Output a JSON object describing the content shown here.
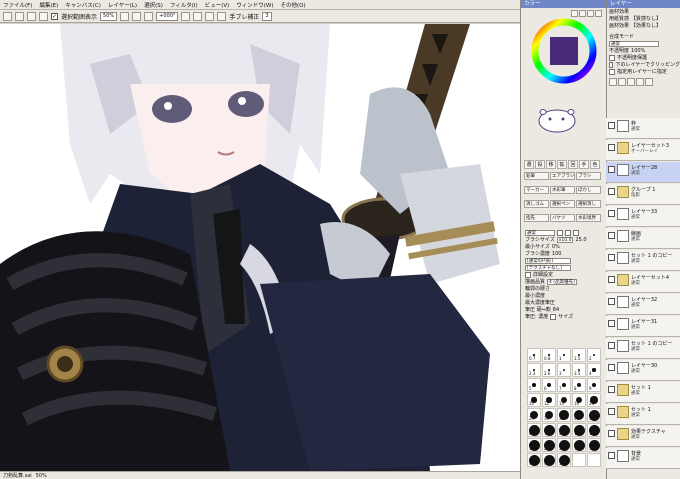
{
  "menubar": {
    "items": [
      "ファイル(F)",
      "編集(E)",
      "キャンバス(C)",
      "レイヤー(L)",
      "選択(S)",
      "フィルタ(I)",
      "ビュー(V)",
      "ウィンドウ(W)",
      "その他(O)"
    ]
  },
  "toolbar": {
    "aa_label": "選択範囲表示",
    "zoom_value": "50%",
    "angle_value": "+000°",
    "stabilizer_label": "手ブレ補正",
    "stabilizer_value": "3"
  },
  "statusbar": {
    "filename": "刀剣乱舞.sai",
    "zoom": "50%"
  },
  "color_panel": {
    "title": "カラー",
    "sv_color": "#4b2a7a",
    "hue_ring": "rainbow"
  },
  "tool_panel": {
    "tools": [
      "選",
      "投",
      "移",
      "拡",
      "回",
      "手",
      "ス",
      "消",
      "色"
    ],
    "brushes": [
      [
        "鉛筆",
        "エアブラシ",
        "ブラシ"
      ],
      [
        "マーカー",
        "水彩筆",
        "ぼかし"
      ],
      [
        "消しゴム",
        "選択ペン",
        "選択消し"
      ],
      [
        "指先",
        "バケツ",
        "水彩境界"
      ]
    ],
    "mode_label": "通常",
    "size_label": "ブラシサイズ",
    "size_mult": "x10.0",
    "size_value": "25.0",
    "min_size_label": "最小サイズ",
    "min_size_value": "0%",
    "density_label": "ブラシ濃度",
    "density_value": "100",
    "shape1": "[通常の円形]",
    "shape2": "[テクスチャなし]",
    "advanced_label": "詳細設定",
    "quality_label": "描画品質",
    "quality_value": "4 (品質優先)",
    "edge_label": "輪郭の硬さ",
    "min_density_label": "最小濃度",
    "max_pressure_label": "最大濃度筆圧",
    "pressure_label": "筆圧 硬⇔軟",
    "pressure_value": "84",
    "pressure2_label": "筆圧: 濃度",
    "pressure3_label": "サイズ",
    "brush_sizes": [
      [
        "0.7",
        "0.8",
        "1",
        "1.5",
        "2"
      ],
      [
        "2.3",
        "2.6",
        "3",
        "3.5",
        "4"
      ],
      [
        "5",
        "6",
        "7",
        "8",
        "9"
      ],
      [
        "10",
        "12",
        "14",
        "16",
        "20"
      ],
      [
        "25",
        "30",
        "35",
        "40",
        "50"
      ],
      [
        "60",
        "70",
        "80",
        "100",
        "120"
      ],
      [
        "160",
        "200",
        "250",
        "300",
        "350"
      ],
      [
        "400",
        "450",
        "500",
        "",
        ""
      ]
    ]
  },
  "layer_panel": {
    "title": "レイヤー",
    "effect_label": "画材効果",
    "paper_label": "用紙質感",
    "paper_value": "【質感なし】",
    "effect_value": "【効果なし】",
    "blend_label": "合成モード",
    "blend_value": "通常",
    "opacity_label": "不透明度",
    "opacity_value": "100%",
    "protect_label": "不透明度保護",
    "clip_label": "下のレイヤーでクリッピング",
    "reference_label": "指定用レイヤーに指定",
    "layers": [
      {
        "name": "枠",
        "mode": "通常",
        "type": "layer"
      },
      {
        "name": "レイヤーセット3",
        "mode": "オーバーレイ",
        "type": "folder"
      },
      {
        "name": "レイヤー28",
        "mode": "通常",
        "type": "layer",
        "selected": true
      },
      {
        "name": "グループ 1",
        "mode": "陰影",
        "type": "folder"
      },
      {
        "name": "レイヤー33",
        "mode": "通常",
        "type": "layer"
      },
      {
        "name": "線画",
        "mode": "通常",
        "type": "layer"
      },
      {
        "name": "セット 1 のコピー",
        "mode": "通常",
        "type": "layer"
      },
      {
        "name": "レイヤーセット4",
        "mode": "通常",
        "type": "folder"
      },
      {
        "name": "レイヤー32",
        "mode": "通常",
        "type": "layer"
      },
      {
        "name": "レイヤー31",
        "mode": "通常",
        "type": "layer"
      },
      {
        "name": "セット 1 のコピー",
        "mode": "通常",
        "type": "layer"
      },
      {
        "name": "レイヤー30",
        "mode": "通常",
        "type": "layer"
      },
      {
        "name": "セット 1",
        "mode": "通常",
        "type": "folder"
      },
      {
        "name": "セット 1",
        "mode": "通常",
        "type": "folder"
      },
      {
        "name": "効果テクスチャ",
        "mode": "通常",
        "type": "folder"
      },
      {
        "name": "背景",
        "mode": "通常",
        "type": "layer"
      }
    ]
  }
}
